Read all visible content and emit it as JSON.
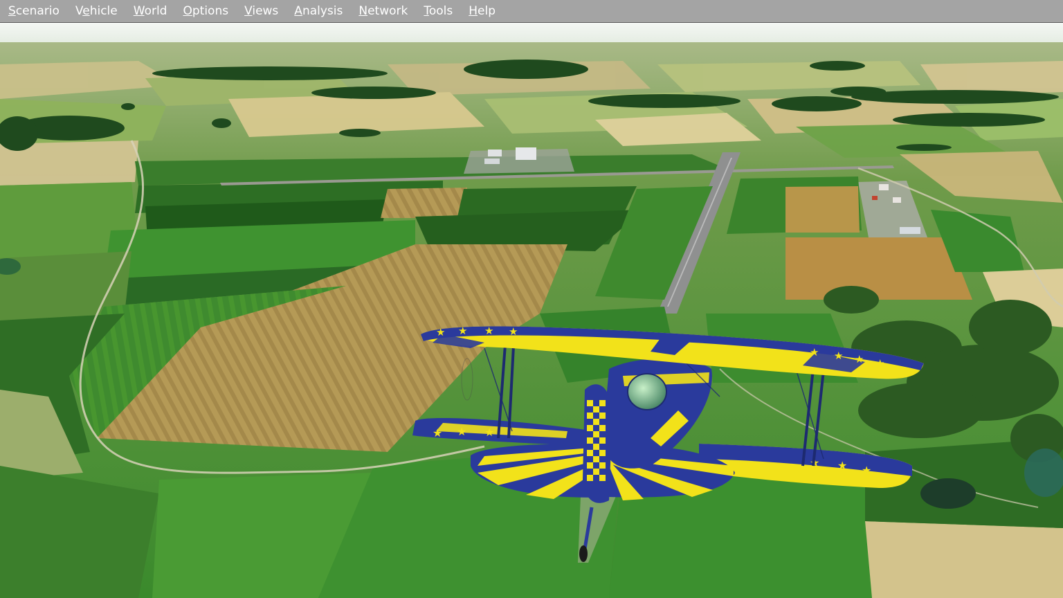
{
  "menubar": {
    "items": [
      {
        "label": "Scenario",
        "accel": "S",
        "rest": "cenario"
      },
      {
        "label": "Vehicle",
        "pre": "V",
        "accel": "e",
        "rest": "hicle"
      },
      {
        "label": "World",
        "accel": "W",
        "rest": "orld"
      },
      {
        "label": "Options",
        "accel": "O",
        "rest": "ptions"
      },
      {
        "label": "Views",
        "accel": "V",
        "rest": "iews"
      },
      {
        "label": "Analysis",
        "accel": "A",
        "rest": "nalysis"
      },
      {
        "label": "Network",
        "accel": "N",
        "rest": "etwork"
      },
      {
        "label": "Tools",
        "accel": "T",
        "rest": "ools"
      },
      {
        "label": "Help",
        "accel": "H",
        "rest": "elp"
      }
    ]
  },
  "scene": {
    "description_icon": "biplane-icon",
    "colors": {
      "sky": "#eef3ee",
      "field_green": "#3d8a2e",
      "field_dark": "#2b6b22",
      "field_wheat": "#b99a52",
      "runway": "#8d8d8d",
      "plane_blue": "#2a3a9c",
      "plane_yellow": "#f2e21a"
    }
  }
}
